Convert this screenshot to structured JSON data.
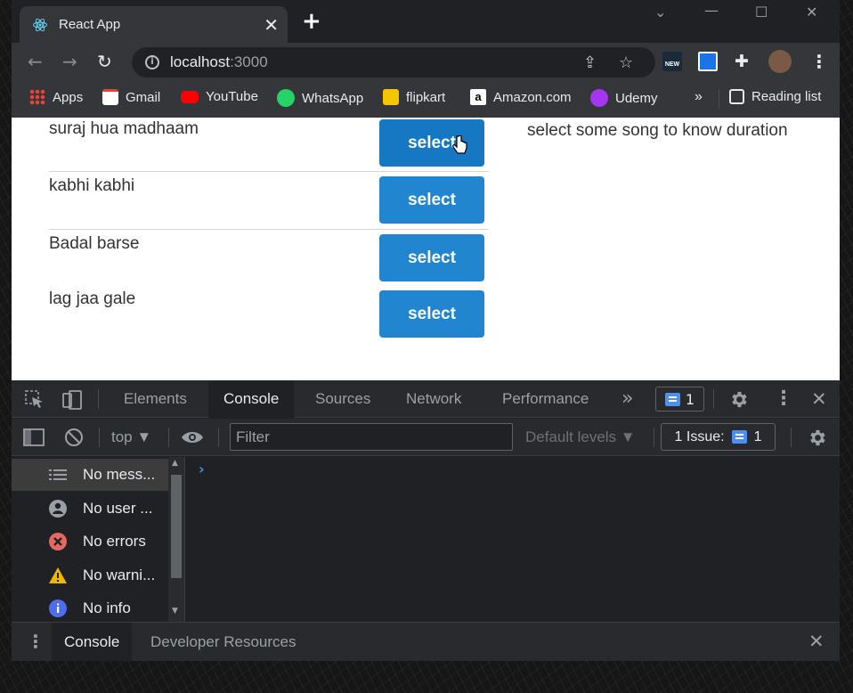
{
  "browser": {
    "tab_title": "React App",
    "url_host": "localhost",
    "url_port": ":3000"
  },
  "bookmarks": [
    {
      "label": "Apps",
      "icon": "apps-grid-icon",
      "color": "#4285f4"
    },
    {
      "label": "Gmail",
      "icon": "gmail-icon",
      "color": "#ea4335"
    },
    {
      "label": "YouTube",
      "icon": "youtube-icon",
      "color": "#ff0000"
    },
    {
      "label": "WhatsApp",
      "icon": "whatsapp-icon",
      "color": "#25d366"
    },
    {
      "label": "flipkart",
      "icon": "flipkart-icon",
      "color": "#f7c600"
    },
    {
      "label": "Amazon.com",
      "icon": "amazon-icon",
      "color": "#ffffff"
    },
    {
      "label": "Udemy",
      "icon": "udemy-icon",
      "color": "#a435f0"
    }
  ],
  "bookmarks_more": "»",
  "reading_list": "Reading list",
  "page": {
    "songs": [
      {
        "name": "suraj hua madhaam",
        "button": "select"
      },
      {
        "name": "kabhi kabhi",
        "button": "select"
      },
      {
        "name": "Badal barse",
        "button": "select"
      },
      {
        "name": "lag jaa gale",
        "button": "select"
      }
    ],
    "duration_message": "select some song to know duration",
    "accent": "#2185d0"
  },
  "devtools": {
    "tabs": [
      "Elements",
      "Console",
      "Sources",
      "Network",
      "Performance"
    ],
    "active_tab": "Console",
    "more_tabs": "»",
    "messages_count": "1",
    "context": "top",
    "filter_placeholder": "Filter",
    "levels": "Default levels",
    "issues_label": "1 Issue:",
    "issues_count": "1",
    "sidebar": [
      {
        "label": "No mess...",
        "icon": "list-icon"
      },
      {
        "label": "No user ...",
        "icon": "user-icon"
      },
      {
        "label": "No errors",
        "icon": "error-icon"
      },
      {
        "label": "No warni...",
        "icon": "warning-icon"
      },
      {
        "label": "No info",
        "icon": "info-icon"
      }
    ],
    "drawer_tabs": [
      "Console",
      "Developer Resources"
    ]
  }
}
